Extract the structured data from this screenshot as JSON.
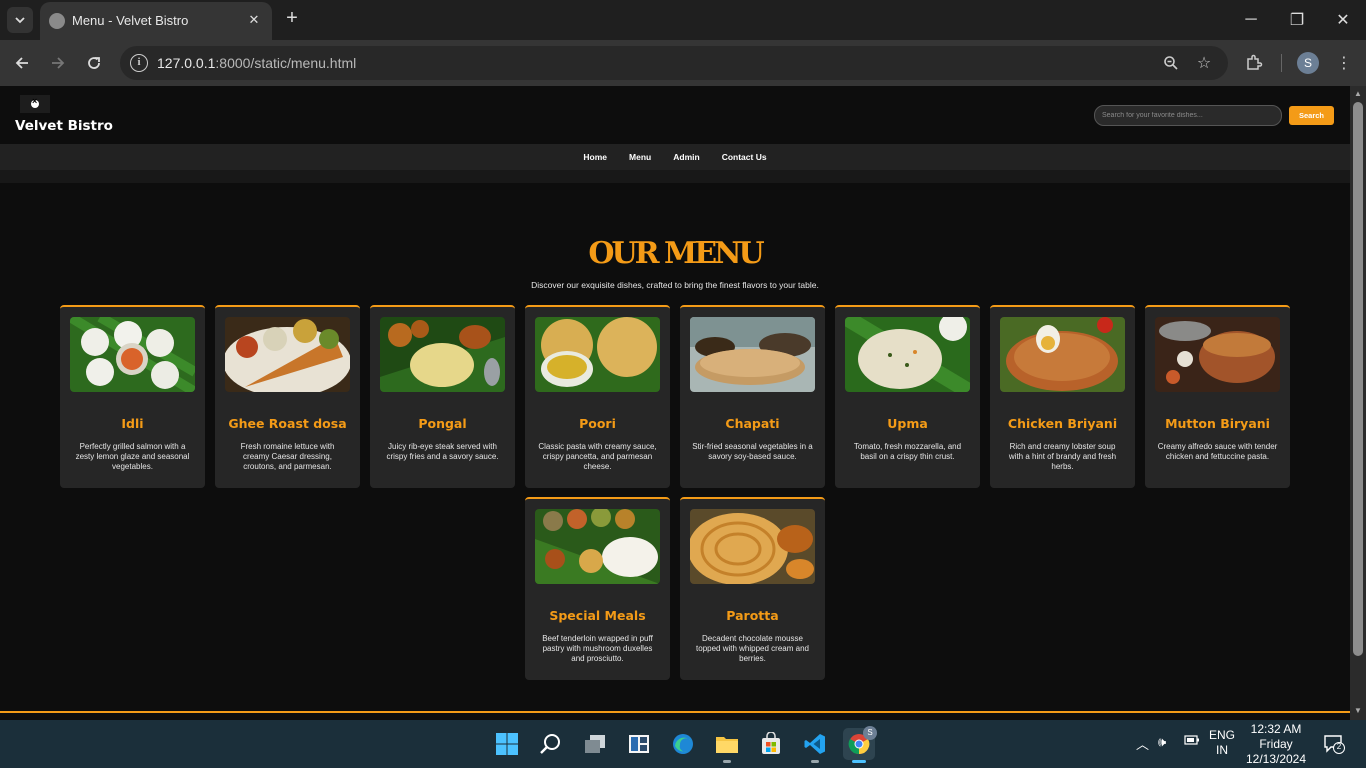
{
  "browser": {
    "tab_title": "Menu - Velvet Bistro",
    "url_host": "127.0.0.1",
    "url_rest": ":8000/static/menu.html",
    "profile_initial": "S"
  },
  "site": {
    "brand": "Velvet Bistro",
    "search_placeholder": "Search for your favorite dishes...",
    "search_button": "Search",
    "nav": [
      "Home",
      "Menu",
      "Admin",
      "Contact Us"
    ]
  },
  "menu": {
    "title": "OUR MENU",
    "subtitle": "Discover our exquisite dishes, crafted to bring the finest flavors to your table.",
    "items": [
      {
        "name": "Idli",
        "desc": "Perfectly grilled salmon with a zesty lemon glaze and seasonal vegetables."
      },
      {
        "name": "Ghee Roast dosa",
        "desc": "Fresh romaine lettuce with creamy Caesar dressing, croutons, and parmesan."
      },
      {
        "name": "Pongal",
        "desc": "Juicy rib-eye steak served with crispy fries and a savory sauce."
      },
      {
        "name": "Poori",
        "desc": "Classic pasta with creamy sauce, crispy pancetta, and parmesan cheese."
      },
      {
        "name": "Chapati",
        "desc": "Stir-fried seasonal vegetables in a savory soy-based sauce."
      },
      {
        "name": "Upma",
        "desc": "Tomato, fresh mozzarella, and basil on a crispy thin crust."
      },
      {
        "name": "Chicken Briyani",
        "desc": "Rich and creamy lobster soup with a hint of brandy and fresh herbs."
      },
      {
        "name": "Mutton Biryani",
        "desc": "Creamy alfredo sauce with tender chicken and fettuccine pasta."
      },
      {
        "name": "Special Meals",
        "desc": "Beef tenderloin wrapped in puff pastry with mushroom duxelles and prosciutto."
      },
      {
        "name": "Parotta",
        "desc": "Decadent chocolate mousse topped with whipped cream and berries."
      }
    ]
  },
  "taskbar": {
    "lang_top": "ENG",
    "lang_bottom": "IN",
    "time": "12:32 AM",
    "day": "Friday",
    "date": "12/13/2024",
    "notifications": "2",
    "chrome_badge": "S"
  },
  "colors": {
    "accent": "#f49b17",
    "page_bg": "#0d0d0d",
    "card_bg": "#262626"
  }
}
